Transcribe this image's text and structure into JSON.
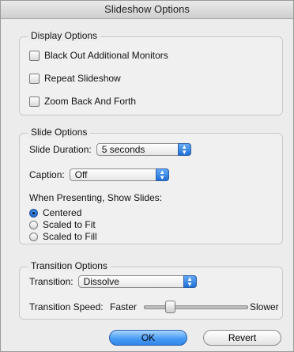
{
  "window": {
    "title": "Slideshow Options"
  },
  "display_options": {
    "legend": "Display Options",
    "items": [
      {
        "label": "Black Out Additional Monitors",
        "checked": false
      },
      {
        "label": "Repeat Slideshow",
        "checked": false
      },
      {
        "label": "Zoom Back And Forth",
        "checked": false
      }
    ]
  },
  "slide_options": {
    "legend": "Slide Options",
    "duration_label": "Slide Duration:",
    "duration_value": "5 seconds",
    "caption_label": "Caption:",
    "caption_value": "Off",
    "present_label": "When Presenting, Show Slides:",
    "radios": [
      {
        "label": "Centered",
        "selected": true
      },
      {
        "label": "Scaled to Fit",
        "selected": false
      },
      {
        "label": "Scaled to Fill",
        "selected": false
      }
    ]
  },
  "transition_options": {
    "legend": "Transition Options",
    "transition_label": "Transition:",
    "transition_value": "Dissolve",
    "speed_label": "Transition Speed:",
    "speed_faster": "Faster",
    "speed_slower": "Slower",
    "speed_fraction": 0.2
  },
  "buttons": {
    "ok": "OK",
    "revert": "Revert"
  }
}
